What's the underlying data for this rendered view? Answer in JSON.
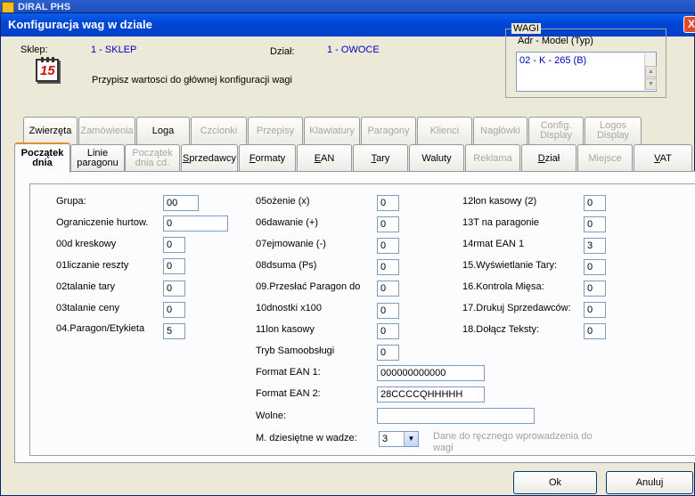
{
  "background": {
    "title": "DIRAL PHS"
  },
  "dialog": {
    "title": "Konfiguracja wag w dziale",
    "close_label": "X"
  },
  "header": {
    "shop_label": "Sklep:",
    "shop_value": "1 - SKLEP",
    "dept_label": "Dział:",
    "dept_value": "1 - OWOCE",
    "assign_text": "Przypisz wartosci do głównej konfiguracji wagi",
    "calendar_number": "15"
  },
  "wagi": {
    "legend": "WAGI",
    "header": "Adr - Model (Typ)",
    "items": [
      "02 - K - 265 (B)"
    ]
  },
  "tabs_row1": [
    {
      "label": "Zwierzęta"
    },
    {
      "label": "Zamówienia"
    },
    {
      "label": "Loga"
    },
    {
      "label": "Czcionki"
    },
    {
      "label": "Przepisy"
    },
    {
      "label": "Klawiatury"
    },
    {
      "label": "Paragony"
    },
    {
      "label": "Klienci"
    },
    {
      "label": "Nagłówki"
    },
    {
      "label": "Config. Display"
    },
    {
      "label": "Logos Display"
    }
  ],
  "tabs_row2": [
    {
      "label": "Początek dnia"
    },
    {
      "label": "Linie paragonu"
    },
    {
      "label": "Początek dnia cd."
    },
    {
      "label": "Sprzedawcy"
    },
    {
      "label": "Formaty"
    },
    {
      "label": "EAN"
    },
    {
      "label": "Tary"
    },
    {
      "label": "Waluty"
    },
    {
      "label": "Reklama"
    },
    {
      "label": "Dział"
    },
    {
      "label": "Miejsce"
    },
    {
      "label": "VAT"
    }
  ],
  "form": {
    "col1": [
      {
        "label": "Grupa:",
        "value": "00"
      },
      {
        "label": "Ograniczenie hurtow.",
        "value": "0"
      },
      {
        "label": "00d kreskowy",
        "value": "0"
      },
      {
        "label": "01liczanie reszty",
        "value": "0"
      },
      {
        "label": "02talanie tary",
        "value": "0"
      },
      {
        "label": "03talanie ceny",
        "value": "0"
      },
      {
        "label": "04.Paragon/Etykieta",
        "value": "5"
      }
    ],
    "col2": [
      {
        "label": "05ożenie (x)",
        "value": "0"
      },
      {
        "label": "06dawanie (+)",
        "value": "0"
      },
      {
        "label": "07ejmowanie (-)",
        "value": "0"
      },
      {
        "label": "08dsuma (Ps)",
        "value": "0"
      },
      {
        "label": "09.Przesłać Paragon do",
        "value": "0"
      },
      {
        "label": "10dnostki x100",
        "value": "0"
      },
      {
        "label": "11lon  kasowy",
        "value": "0"
      },
      {
        "label": "Tryb Samoobsługi",
        "value": "0"
      }
    ],
    "col3": [
      {
        "label": "12lon kasowy (2)",
        "value": "0"
      },
      {
        "label": "13T na paragonie",
        "value": "0"
      },
      {
        "label": "14rmat EAN 1",
        "value": "3"
      },
      {
        "label": "15.Wyświetlanie Tary:",
        "value": "0"
      },
      {
        "label": "16.Kontrola Mięsa:",
        "value": "0"
      },
      {
        "label": "17.Drukuj Sprzedawców:",
        "value": "0"
      },
      {
        "label": "18.Dołącz Teksty:",
        "value": "0"
      }
    ],
    "format_ean1_label": "Format EAN 1:",
    "format_ean1_value": "000000000000",
    "format_ean2_label": "Format EAN 2:",
    "format_ean2_value": "28CCCCQHHHHH",
    "wolne_label": "Wolne:",
    "wolne_value": "",
    "decimal_label": "M. dziesiętne w wadze:",
    "decimal_value": "3",
    "hint": "Dane do ręcznego wprowadzenia do wagi"
  },
  "buttons": {
    "ok": "Ok",
    "cancel": "Anuluj"
  },
  "colors": {
    "titlebar": "#0046d5",
    "active_tab_accent": "#e68b2c",
    "value_text": "#0000c0"
  }
}
